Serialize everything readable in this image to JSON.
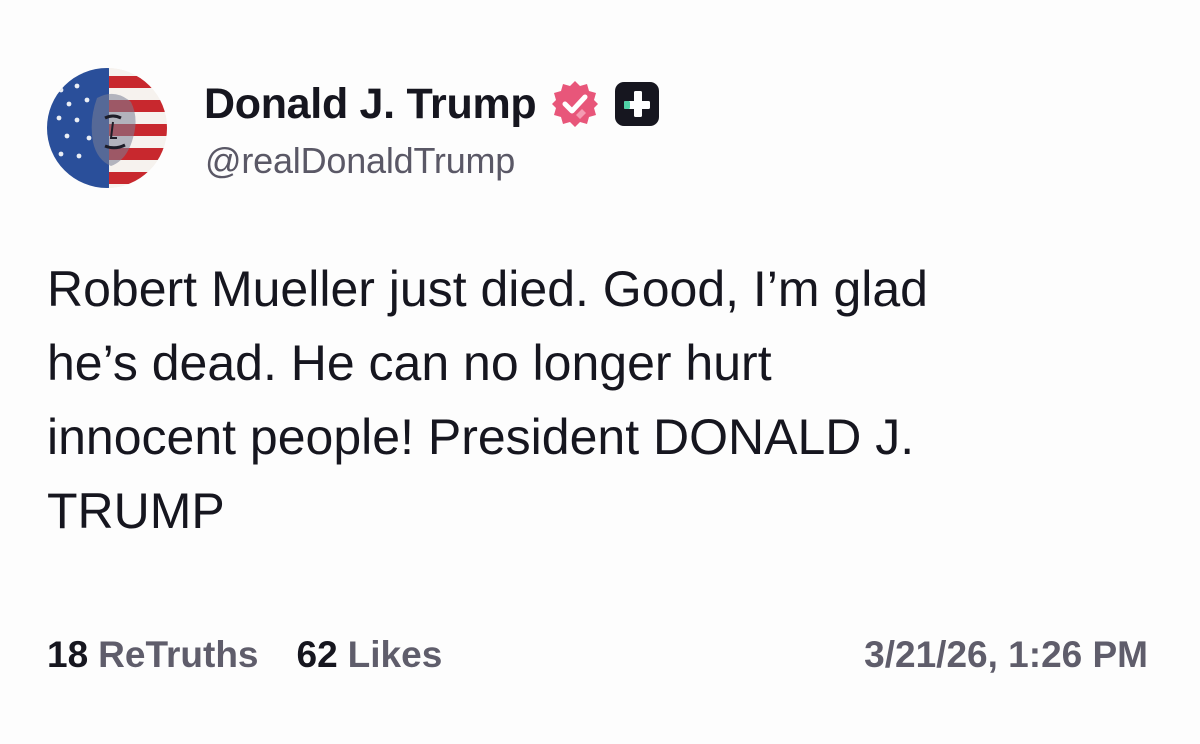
{
  "author": {
    "display_name": "Donald J. Trump",
    "handle": "@realDonaldTrump",
    "avatar_icon": "avatar-flag-portrait",
    "verified_icon": "verified-badge-icon",
    "plus_icon": "plus-badge-icon"
  },
  "post": {
    "text": "Robert Mueller just died. Good, I’m glad\nhe’s dead. He can no longer hurt\ninnocent people! President DONALD J.\nTRUMP"
  },
  "stats": {
    "retruths_count": "18",
    "retruths_label": "ReTruths",
    "likes_count": "62",
    "likes_label": "Likes"
  },
  "timestamp": "3/21/26, 1:26 PM",
  "colors": {
    "verified": "#e8567a",
    "plus_badge": "#16161f",
    "plus_accent": "#4fd1a5",
    "text_primary": "#16161f",
    "text_secondary": "#5f5d6b"
  }
}
